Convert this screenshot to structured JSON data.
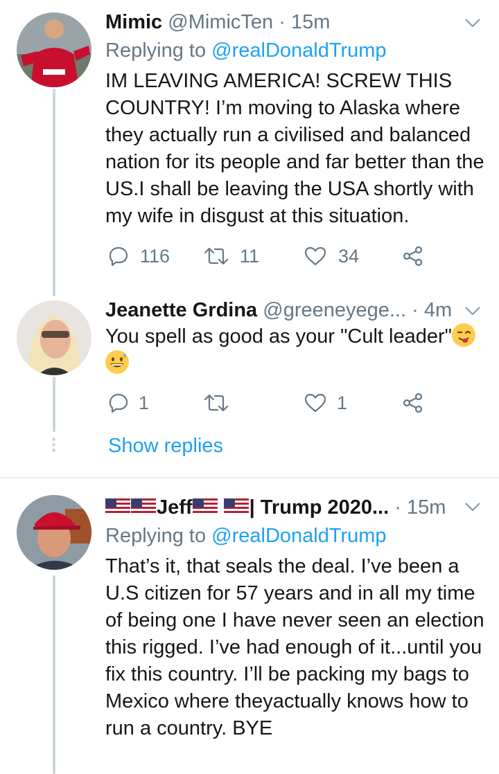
{
  "tweets": [
    {
      "name": "Mimic",
      "handle": "@MimicTen",
      "time": "15m",
      "replying_prefix": "Replying to",
      "replying_to": "@realDonaldTrump",
      "text": "IM LEAVING AMERICA! SCREW THIS COUNTRY! I’m moving to Alaska where they actually run a civilised and balanced nation for its people and far better than the US.I shall be leaving the USA shortly with my wife in disgust at this situation.",
      "replies": "116",
      "retweets": "11",
      "likes": "34"
    },
    {
      "name": "Jeanette Grdina",
      "handle": "@greeneyege...",
      "time": "4m",
      "text": "You spell as good as your \"Cult leader\"",
      "emoji_1": "winking-face-with-tongue",
      "emoji_2": "grinning-face-with-sweat",
      "replies": "1",
      "retweets": "",
      "likes": "1",
      "show_replies": "Show replies"
    },
    {
      "name_part1": "Jeff",
      "name_part2": "| Trump 2020...",
      "time": "15m",
      "replying_prefix": "Replying to",
      "replying_to": "@realDonaldTrump",
      "text": "That’s it, that seals the deal. I’ve been a U.S citizen for 57 years and in all my time of being one I have never seen an election this rigged. I’ve had enough of it...until you fix this country. I’ll be packing my bags to Mexico where theyactually knows how to run a country. BYE"
    }
  ],
  "colors": {
    "accent": "#1da1f2",
    "secondary_text": "#657786",
    "thread_line": "#ccd6dd",
    "divider": "#e6ecf0"
  },
  "icons": [
    "reply-icon",
    "retweet-icon",
    "like-icon",
    "share-icon",
    "chevron-down-icon",
    "us-flag-icon"
  ]
}
